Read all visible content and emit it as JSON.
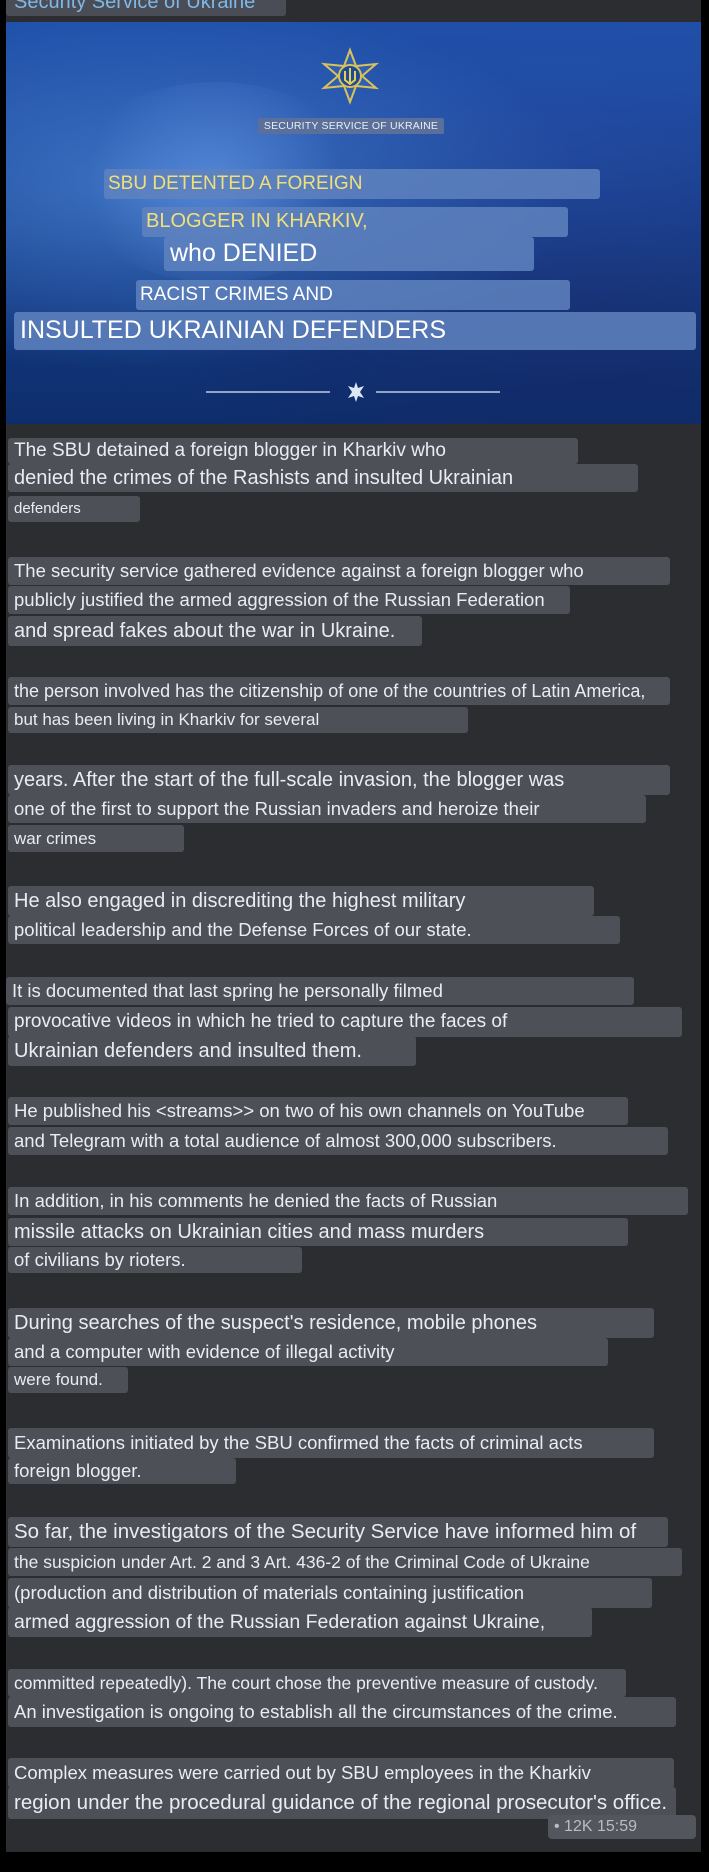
{
  "header": {
    "channel_name": "Security Service of Ukraine"
  },
  "banner": {
    "org_label": "SECURITY SERVICE OF UKRAINE",
    "headline_lines": [
      "SBU DETENTED A FOREIGN",
      "BLOGGER IN KHARKIV,",
      "who DENIED",
      "RACIST CRIMES AND",
      "INSULTED UKRAINIAN DEFENDERS"
    ]
  },
  "body_lines": [
    "The SBU detained a foreign blogger in Kharkiv who",
    "denied the crimes of the Rashists and insulted Ukrainian",
    "defenders",
    "The security service gathered evidence against a foreign blogger who",
    "publicly justified the armed aggression of the Russian Federation",
    "and spread fakes about the war in Ukraine.",
    "the person involved has the citizenship of one of the countries of Latin America,",
    "but has been living in Kharkiv for several",
    "years. After the start of the full-scale invasion, the blogger was",
    "one of the first to support the Russian invaders and heroize their",
    "war crimes",
    "He also engaged in discrediting the highest military",
    "political leadership and the Defense Forces of our state.",
    "It is documented that last spring he personally filmed",
    "provocative videos in which he tried to capture the faces of",
    "Ukrainian defenders and insulted them.",
    "He published his <streams>> on two of his own channels on YouTube",
    "and Telegram with a total audience of almost 300,000 subscribers.",
    "In addition, in his comments he denied the facts of Russian",
    "missile attacks on Ukrainian cities and mass murders",
    "of civilians by rioters.",
    "During searches of the suspect's residence, mobile phones",
    "and a computer with evidence of illegal activity",
    "were found.",
    "Examinations initiated by the SBU confirmed the facts of criminal acts",
    "foreign blogger.",
    "So far, the investigators of the Security Service have informed him of",
    "the suspicion under Art. 2 and 3 Art. 436-2 of the Criminal Code of Ukraine",
    "(production and distribution of materials containing justification",
    "armed aggression of the Russian Federation against Ukraine,",
    "committed repeatedly). The court chose the preventive measure of custody.",
    "An investigation is ongoing to establish all the circumstances of the crime.",
    "Complex measures were carried out by SBU employees in the Kharkiv",
    "region under the procedural guidance of the regional prosecutor's office."
  ],
  "footer": {
    "meta": "• 12K 15:59"
  },
  "colors": {
    "background": "#000000",
    "message_bg": "#2b2d31",
    "line_highlight": "#4e5057",
    "banner_blue": "#1d4ea8",
    "headline_yellow": "#f0e07a"
  }
}
